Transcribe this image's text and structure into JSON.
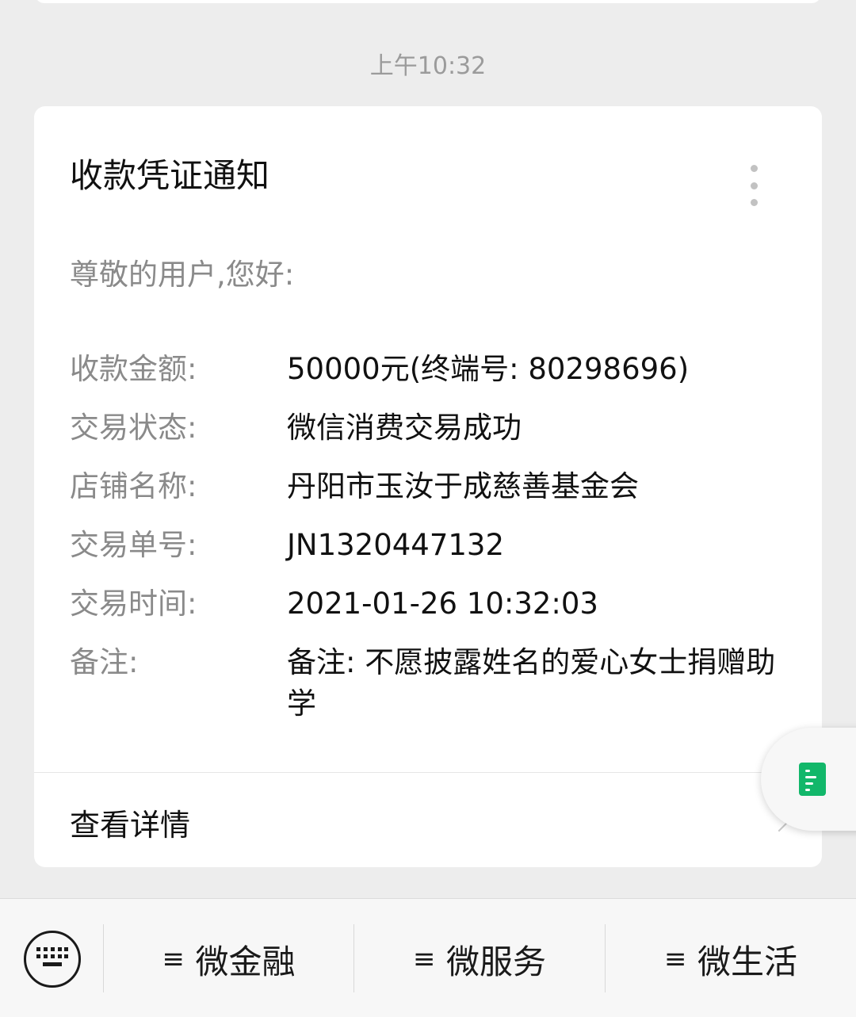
{
  "chat": {
    "timestamp": "上午10:32"
  },
  "card": {
    "title": "收款凭证通知",
    "greeting": "尊敬的用户,您好:",
    "fields": [
      {
        "label": "收款金额:",
        "value": "50000元(终端号: 80298696)"
      },
      {
        "label": "交易状态:",
        "value": "微信消费交易成功"
      },
      {
        "label": "店铺名称:",
        "value": "丹阳市玉汝于成慈善基金会"
      },
      {
        "label": "交易单号:",
        "value": "JN1320447132"
      },
      {
        "label": "交易时间:",
        "value": "2021-01-26 10:32:03"
      },
      {
        "label": "备注:",
        "value": "备注: 不愿披露姓名的爱心女士捐赠助学"
      }
    ],
    "details_label": "查看详情"
  },
  "menu": {
    "items": [
      {
        "label": "微金融",
        "icon": "≡"
      },
      {
        "label": "微服务",
        "icon": "≡"
      },
      {
        "label": "微生活",
        "icon": "≡"
      }
    ]
  },
  "icons": {
    "more": "more-vertical-icon",
    "keyboard": "keyboard-icon",
    "float": "document-icon",
    "menu": "menu-lines-icon"
  },
  "colors": {
    "background": "#ededed",
    "card": "#ffffff",
    "label_gray": "#8a8a8a",
    "doc_green": "#12b76a"
  }
}
